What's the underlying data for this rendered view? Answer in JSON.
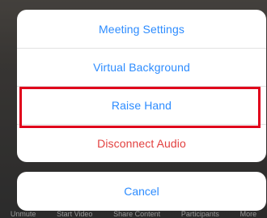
{
  "action_sheet": {
    "items": [
      {
        "label": "Meeting Settings"
      },
      {
        "label": "Virtual Background"
      },
      {
        "label": "Raise Hand"
      },
      {
        "label": "Disconnect Audio"
      }
    ],
    "cancel_label": "Cancel"
  },
  "toolbar": {
    "items": [
      "Unmute",
      "Start Video",
      "Share Content",
      "Participants",
      "More"
    ]
  },
  "colors": {
    "action_blue": "#2d8cff",
    "destructive_red": "#e2403f",
    "highlight_red": "#e0001b"
  }
}
